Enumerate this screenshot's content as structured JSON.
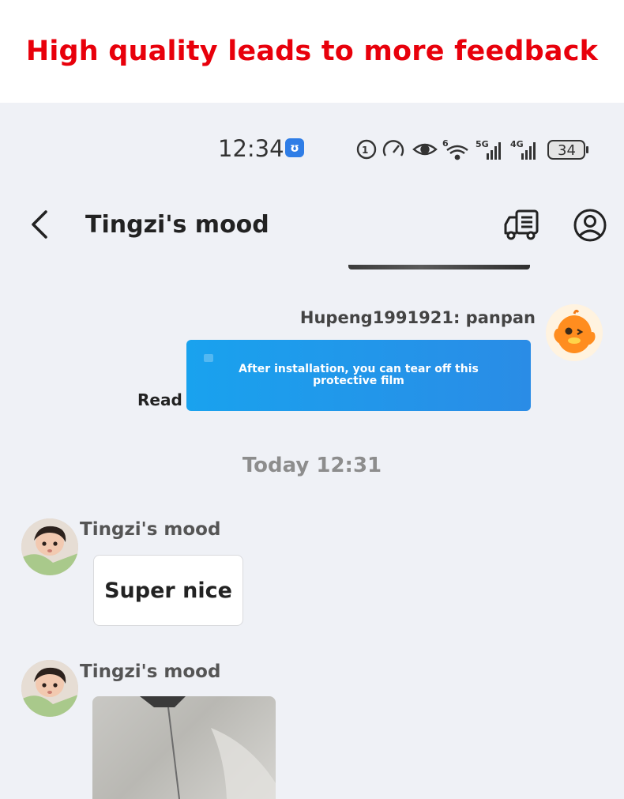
{
  "banner": {
    "text": "High quality leads to more feedback",
    "color": "#e8000b"
  },
  "status_bar": {
    "time": "12:34",
    "app_icon": "shield-badge-icon",
    "battery_level": "34",
    "network_labels": [
      "6",
      "5G",
      "4G"
    ],
    "icons": [
      "hd-call-icon",
      "speedometer-icon",
      "eye-icon",
      "wifi-icon",
      "signal-5g-icon",
      "signal-4g-icon",
      "battery-icon"
    ]
  },
  "nav": {
    "title": "Tingzi's mood",
    "back_icon": "chevron-left-icon",
    "truck_icon": "delivery-truck-icon",
    "profile_icon": "user-profile-icon"
  },
  "messages": {
    "sent": {
      "sender": "Hupeng1991921: panpan",
      "text": "After installation, you can tear off this protective film",
      "status": "Read",
      "bubble_color": "#1a9eed"
    },
    "date_separator": "Today 12:31",
    "received": [
      {
        "sender": "Tingzi's mood",
        "text": "Super nice"
      },
      {
        "sender": "Tingzi's mood",
        "type": "image"
      }
    ]
  }
}
